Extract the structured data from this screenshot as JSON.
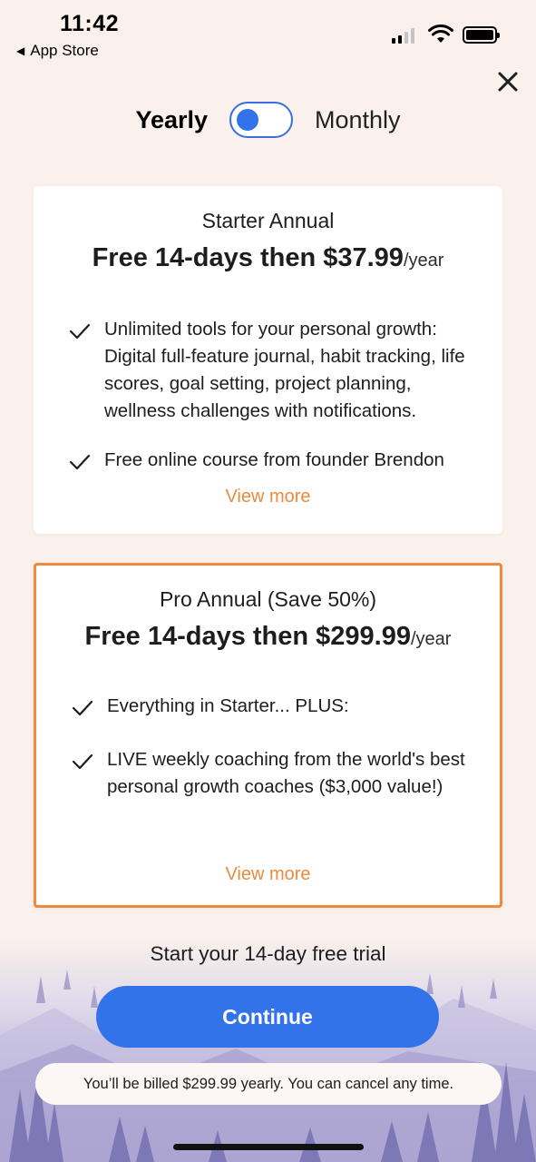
{
  "status_bar": {
    "time": "11:42",
    "back_app_label": "App Store"
  },
  "toggle": {
    "yearly_label": "Yearly",
    "monthly_label": "Monthly",
    "selected": "Yearly",
    "accent_color": "#3373ea"
  },
  "plans": [
    {
      "name": "Starter Annual",
      "price_text": "Free 14-days then $37.99",
      "period": "/year",
      "features": [
        "Unlimited tools for your personal growth: Digital full-feature journal, habit tracking, life scores, goal setting, project planning, wellness challenges with notifications.",
        "Free online course from founder Brendon"
      ],
      "view_more": "View more",
      "selected": false
    },
    {
      "name": "Pro Annual (Save 50%)",
      "price_text": "Free 14-days then $299.99",
      "period": "/year",
      "features": [
        "Everything in Starter... PLUS:",
        "LIVE weekly coaching from the world's best personal growth coaches ($3,000 value!)"
      ],
      "view_more": "View more",
      "selected": true,
      "border_color": "#ec8a3e"
    }
  ],
  "footer": {
    "trial_text": "Start your 14-day free trial",
    "continue_label": "Continue",
    "billing_note": "You’ll be billed $299.99 yearly. You can cancel any time."
  },
  "colors": {
    "background": "#fbf1ec",
    "primary": "#3373ea",
    "accent_orange": "#eb8a3f"
  }
}
